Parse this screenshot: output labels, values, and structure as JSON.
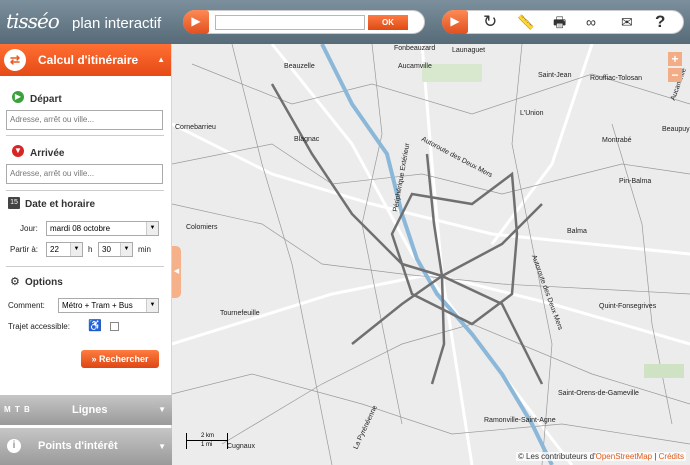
{
  "header": {
    "logo": "tisséo",
    "subtitle": "plan interactif",
    "search_value": "",
    "search_button": "OK",
    "tools": [
      "refresh-icon",
      "measure-icon",
      "print-icon",
      "link-icon",
      "mail-icon",
      "help-icon"
    ]
  },
  "sidebar": {
    "title": "Calcul d'itinéraire",
    "depart_label": "Départ",
    "depart_placeholder": "Adresse, arrêt ou ville...",
    "arrivee_label": "Arrivée",
    "arrivee_placeholder": "Adresse, arrêt ou ville...",
    "date_label": "Date et horaire",
    "date_icon_number": "15",
    "jour_label": "Jour:",
    "jour_value": "mardi 08 octobre",
    "partir_label": "Partir à:",
    "hour_value": "22",
    "h_label": "h",
    "min_value": "30",
    "min_label": "min",
    "options_label": "Options",
    "comment_label": "Comment:",
    "comment_value": "Métro + Tram + Bus",
    "accessible_label": "Trajet accessible:",
    "search_button": "» Rechercher",
    "lignes_label": "Lignes",
    "lignes_icons": "M T B",
    "poi_label": "Points d'intérêt"
  },
  "map": {
    "towns": [
      "Fonbeauzard",
      "Launaguet",
      "Beauzelle",
      "Aucamville",
      "Saint-Jean",
      "Rouffiac-Tolosan",
      "Aucamville",
      "Cornebarrieu",
      "Blagnac",
      "L'Union",
      "Beaupuy",
      "Montrabé",
      "Pin-Balma",
      "Colomiers",
      "Balma",
      "Tournefeuille",
      "Quint-Fonsegrives",
      "Saint-Orens-de-Gameville",
      "Ramonville-Saint-Agne",
      "Cugnaux"
    ],
    "roads": [
      "Autoroute des Deux Mers",
      "Périphérique Extérieur",
      "Autoroute des Deux Mers",
      "La Pyrénéenne"
    ],
    "scale_top": "2 km",
    "scale_bottom": "1 mi",
    "attribution_prefix": "© Les contributeurs d'",
    "attribution_link": "OpenStreetMap",
    "attribution_sep": "|",
    "attribution_credits": "Crédits",
    "zoom_in": "+",
    "zoom_out": "−"
  },
  "colors": {
    "accent": "#e85a22",
    "header_bg": "#62757f"
  }
}
